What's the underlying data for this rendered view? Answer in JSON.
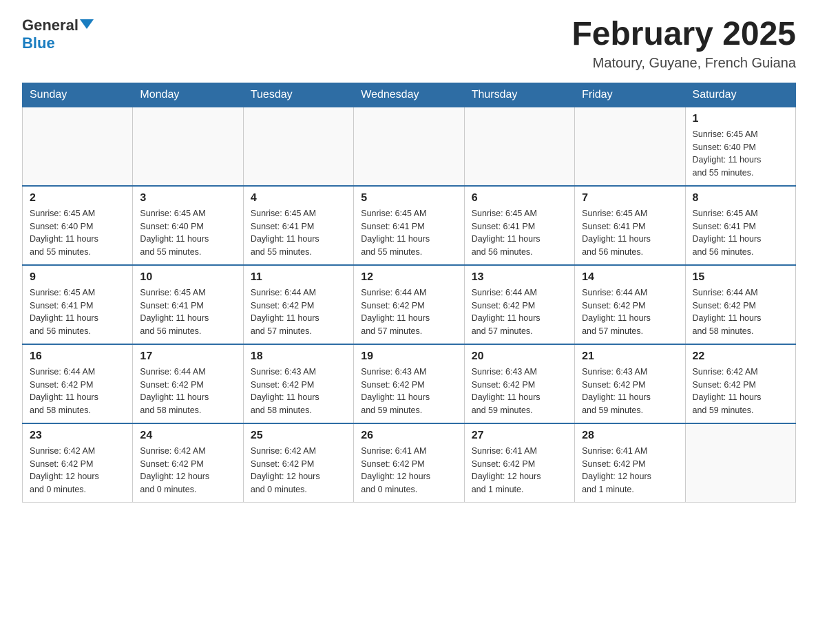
{
  "header": {
    "logo_general": "General",
    "logo_blue": "Blue",
    "month_title": "February 2025",
    "location": "Matoury, Guyane, French Guiana"
  },
  "weekdays": [
    "Sunday",
    "Monday",
    "Tuesday",
    "Wednesday",
    "Thursday",
    "Friday",
    "Saturday"
  ],
  "weeks": [
    [
      {
        "day": "",
        "info": ""
      },
      {
        "day": "",
        "info": ""
      },
      {
        "day": "",
        "info": ""
      },
      {
        "day": "",
        "info": ""
      },
      {
        "day": "",
        "info": ""
      },
      {
        "day": "",
        "info": ""
      },
      {
        "day": "1",
        "info": "Sunrise: 6:45 AM\nSunset: 6:40 PM\nDaylight: 11 hours\nand 55 minutes."
      }
    ],
    [
      {
        "day": "2",
        "info": "Sunrise: 6:45 AM\nSunset: 6:40 PM\nDaylight: 11 hours\nand 55 minutes."
      },
      {
        "day": "3",
        "info": "Sunrise: 6:45 AM\nSunset: 6:40 PM\nDaylight: 11 hours\nand 55 minutes."
      },
      {
        "day": "4",
        "info": "Sunrise: 6:45 AM\nSunset: 6:41 PM\nDaylight: 11 hours\nand 55 minutes."
      },
      {
        "day": "5",
        "info": "Sunrise: 6:45 AM\nSunset: 6:41 PM\nDaylight: 11 hours\nand 55 minutes."
      },
      {
        "day": "6",
        "info": "Sunrise: 6:45 AM\nSunset: 6:41 PM\nDaylight: 11 hours\nand 56 minutes."
      },
      {
        "day": "7",
        "info": "Sunrise: 6:45 AM\nSunset: 6:41 PM\nDaylight: 11 hours\nand 56 minutes."
      },
      {
        "day": "8",
        "info": "Sunrise: 6:45 AM\nSunset: 6:41 PM\nDaylight: 11 hours\nand 56 minutes."
      }
    ],
    [
      {
        "day": "9",
        "info": "Sunrise: 6:45 AM\nSunset: 6:41 PM\nDaylight: 11 hours\nand 56 minutes."
      },
      {
        "day": "10",
        "info": "Sunrise: 6:45 AM\nSunset: 6:41 PM\nDaylight: 11 hours\nand 56 minutes."
      },
      {
        "day": "11",
        "info": "Sunrise: 6:44 AM\nSunset: 6:42 PM\nDaylight: 11 hours\nand 57 minutes."
      },
      {
        "day": "12",
        "info": "Sunrise: 6:44 AM\nSunset: 6:42 PM\nDaylight: 11 hours\nand 57 minutes."
      },
      {
        "day": "13",
        "info": "Sunrise: 6:44 AM\nSunset: 6:42 PM\nDaylight: 11 hours\nand 57 minutes."
      },
      {
        "day": "14",
        "info": "Sunrise: 6:44 AM\nSunset: 6:42 PM\nDaylight: 11 hours\nand 57 minutes."
      },
      {
        "day": "15",
        "info": "Sunrise: 6:44 AM\nSunset: 6:42 PM\nDaylight: 11 hours\nand 58 minutes."
      }
    ],
    [
      {
        "day": "16",
        "info": "Sunrise: 6:44 AM\nSunset: 6:42 PM\nDaylight: 11 hours\nand 58 minutes."
      },
      {
        "day": "17",
        "info": "Sunrise: 6:44 AM\nSunset: 6:42 PM\nDaylight: 11 hours\nand 58 minutes."
      },
      {
        "day": "18",
        "info": "Sunrise: 6:43 AM\nSunset: 6:42 PM\nDaylight: 11 hours\nand 58 minutes."
      },
      {
        "day": "19",
        "info": "Sunrise: 6:43 AM\nSunset: 6:42 PM\nDaylight: 11 hours\nand 59 minutes."
      },
      {
        "day": "20",
        "info": "Sunrise: 6:43 AM\nSunset: 6:42 PM\nDaylight: 11 hours\nand 59 minutes."
      },
      {
        "day": "21",
        "info": "Sunrise: 6:43 AM\nSunset: 6:42 PM\nDaylight: 11 hours\nand 59 minutes."
      },
      {
        "day": "22",
        "info": "Sunrise: 6:42 AM\nSunset: 6:42 PM\nDaylight: 11 hours\nand 59 minutes."
      }
    ],
    [
      {
        "day": "23",
        "info": "Sunrise: 6:42 AM\nSunset: 6:42 PM\nDaylight: 12 hours\nand 0 minutes."
      },
      {
        "day": "24",
        "info": "Sunrise: 6:42 AM\nSunset: 6:42 PM\nDaylight: 12 hours\nand 0 minutes."
      },
      {
        "day": "25",
        "info": "Sunrise: 6:42 AM\nSunset: 6:42 PM\nDaylight: 12 hours\nand 0 minutes."
      },
      {
        "day": "26",
        "info": "Sunrise: 6:41 AM\nSunset: 6:42 PM\nDaylight: 12 hours\nand 0 minutes."
      },
      {
        "day": "27",
        "info": "Sunrise: 6:41 AM\nSunset: 6:42 PM\nDaylight: 12 hours\nand 1 minute."
      },
      {
        "day": "28",
        "info": "Sunrise: 6:41 AM\nSunset: 6:42 PM\nDaylight: 12 hours\nand 1 minute."
      },
      {
        "day": "",
        "info": ""
      }
    ]
  ]
}
